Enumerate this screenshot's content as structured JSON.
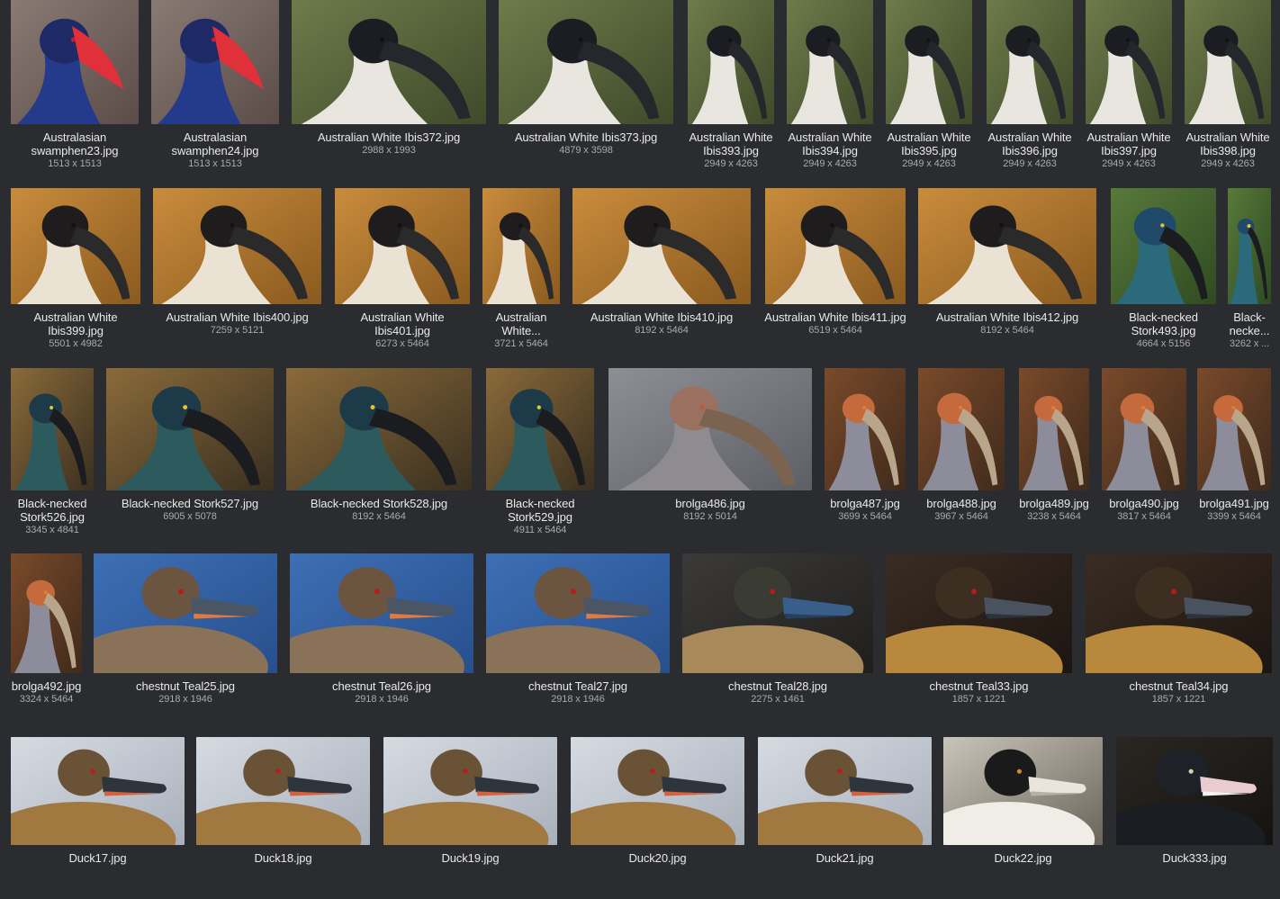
{
  "rows": [
    {
      "items": [
        {
          "name": "Australasian swamphen23.jpg",
          "dims": "1513 x 1513",
          "bird": "swamphen"
        },
        {
          "name": "Australasian swamphen24.jpg",
          "dims": "1513 x 1513",
          "bird": "swamphen"
        },
        {
          "name": "Australian White Ibis372.jpg",
          "dims": "2988 x 1993",
          "bird": "ibis"
        },
        {
          "name": "Australian White Ibis373.jpg",
          "dims": "4879 x 3598",
          "bird": "ibis"
        },
        {
          "name": "Australian White Ibis393.jpg",
          "dims": "2949 x 4263",
          "bird": "ibis"
        },
        {
          "name": "Australian White Ibis394.jpg",
          "dims": "2949 x 4263",
          "bird": "ibis"
        },
        {
          "name": "Australian White Ibis395.jpg",
          "dims": "2949 x 4263",
          "bird": "ibis"
        },
        {
          "name": "Australian White Ibis396.jpg",
          "dims": "2949 x 4263",
          "bird": "ibis"
        },
        {
          "name": "Australian White Ibis397.jpg",
          "dims": "2949 x 4263",
          "bird": "ibis"
        },
        {
          "name": "Australian White Ibis398.jpg",
          "dims": "2949 x 4263",
          "bird": "ibis"
        }
      ]
    },
    {
      "items": [
        {
          "name": "Australian White Ibis399.jpg",
          "dims": "5501 x 4982",
          "bird": "ibis-warm"
        },
        {
          "name": "Australian White Ibis400.jpg",
          "dims": "7259 x 5121",
          "bird": "ibis-warm"
        },
        {
          "name": "Australian White Ibis401.jpg",
          "dims": "6273 x 5464",
          "bird": "ibis-warm"
        },
        {
          "name": "Australian White...",
          "dims": "3721 x 5464",
          "bird": "ibis-warm"
        },
        {
          "name": "Australian White Ibis410.jpg",
          "dims": "8192 x 5464",
          "bird": "ibis-warm"
        },
        {
          "name": "Australian White Ibis411.jpg",
          "dims": "6519 x 5464",
          "bird": "ibis-warm"
        },
        {
          "name": "Australian White Ibis412.jpg",
          "dims": "8192 x 5464",
          "bird": "ibis-warm"
        },
        {
          "name": "Black-necked Stork493.jpg",
          "dims": "4664 x 5156",
          "bird": "stork-green"
        },
        {
          "name": "Black-necke...",
          "dims": "3262 x ...",
          "bird": "stork-green"
        }
      ]
    },
    {
      "items": [
        {
          "name": "Black-necked Stork526.jpg",
          "dims": "3345 x 4841",
          "bird": "stork"
        },
        {
          "name": "Black-necked Stork527.jpg",
          "dims": "6905 x 5078",
          "bird": "stork"
        },
        {
          "name": "Black-necked Stork528.jpg",
          "dims": "8192 x 5464",
          "bird": "stork"
        },
        {
          "name": "Black-necked Stork529.jpg",
          "dims": "4911 x 5464",
          "bird": "stork"
        },
        {
          "name": "brolga486.jpg",
          "dims": "8192 x 5014",
          "bird": "brolga-grey"
        },
        {
          "name": "brolga487.jpg",
          "dims": "3699 x 5464",
          "bird": "brolga"
        },
        {
          "name": "brolga488.jpg",
          "dims": "3967 x 5464",
          "bird": "brolga"
        },
        {
          "name": "brolga489.jpg",
          "dims": "3238 x 5464",
          "bird": "brolga"
        },
        {
          "name": "brolga490.jpg",
          "dims": "3817 x 5464",
          "bird": "brolga"
        },
        {
          "name": "brolga491.jpg",
          "dims": "3399 x 5464",
          "bird": "brolga"
        }
      ]
    },
    {
      "items": [
        {
          "name": "brolga492.jpg",
          "dims": "3324 x 5464",
          "bird": "brolga"
        },
        {
          "name": "chestnut Teal25.jpg",
          "dims": "2918 x 1946",
          "bird": "teal-blue"
        },
        {
          "name": "chestnut Teal26.jpg",
          "dims": "2918 x 1946",
          "bird": "teal-blue"
        },
        {
          "name": "chestnut Teal27.jpg",
          "dims": "2918 x 1946",
          "bird": "teal-blue"
        },
        {
          "name": "chestnut Teal28.jpg",
          "dims": "2275 x 1461",
          "bird": "teal-dark"
        },
        {
          "name": "chestnut Teal33.jpg",
          "dims": "1857 x 1221",
          "bird": "teal-brown"
        },
        {
          "name": "chestnut Teal34.jpg",
          "dims": "1857 x 1221",
          "bird": "teal-brown"
        }
      ]
    },
    {
      "items": [
        {
          "name": "Duck17.jpg",
          "dims": "",
          "bird": "duck"
        },
        {
          "name": "Duck18.jpg",
          "dims": "",
          "bird": "duck"
        },
        {
          "name": "Duck19.jpg",
          "dims": "",
          "bird": "duck"
        },
        {
          "name": "Duck20.jpg",
          "dims": "",
          "bird": "duck"
        },
        {
          "name": "Duck21.jpg",
          "dims": "",
          "bird": "duck"
        },
        {
          "name": "Duck22.jpg",
          "dims": "",
          "bird": "muscovy-white"
        },
        {
          "name": "Duck333.jpg",
          "dims": "",
          "bird": "muscovy-black"
        }
      ]
    }
  ]
}
